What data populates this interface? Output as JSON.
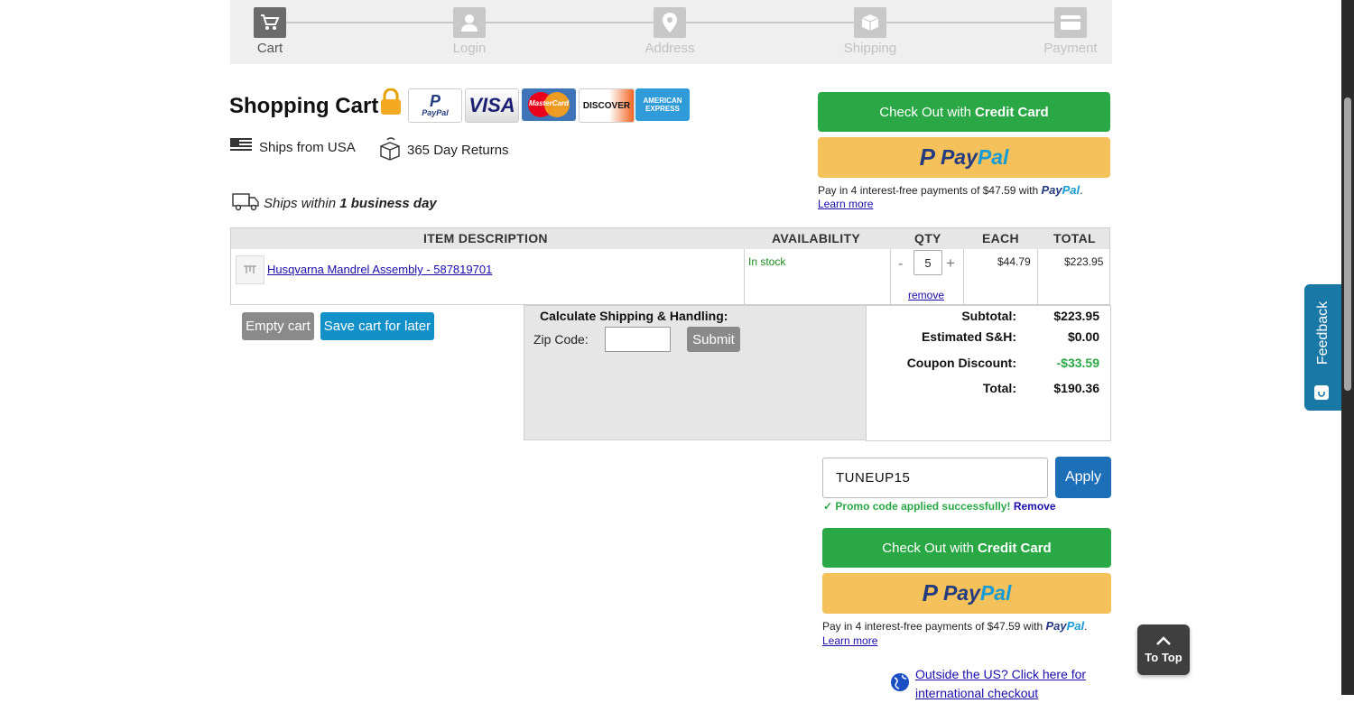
{
  "steps": [
    {
      "label": "Cart",
      "icon": "cart-icon",
      "active": true
    },
    {
      "label": "Login",
      "icon": "user-icon",
      "active": false
    },
    {
      "label": "Address",
      "icon": "map-pin-icon",
      "active": false
    },
    {
      "label": "Shipping",
      "icon": "box-icon",
      "active": false
    },
    {
      "label": "Payment",
      "icon": "credit-card-icon",
      "active": false
    }
  ],
  "header": {
    "title": "Shopping Cart",
    "payment_logos": [
      "PayPal",
      "VISA",
      "MasterCard",
      "DISCOVER",
      "AMERICAN EXPRESS"
    ]
  },
  "info": {
    "ships_from": "Ships from USA",
    "returns": "365 Day Returns",
    "ships_within_pre": "Ships within ",
    "ships_within_bold": "1 business day"
  },
  "checkout": {
    "credit_pre": "Check Out with ",
    "credit_bold": "Credit Card",
    "paypal_a": "Pay",
    "paypal_b": "Pal",
    "pay_in_4": "Pay in 4 interest-free payments of $47.59 with",
    "learn_more": "Learn more"
  },
  "table": {
    "headers": {
      "item": "ITEM DESCRIPTION",
      "availability": "AVAILABILITY",
      "qty": "QTY",
      "each": "EACH",
      "total": "TOTAL"
    },
    "row": {
      "name": "Husqvarna Mandrel Assembly - 587819701",
      "availability": "In stock",
      "qty": "5",
      "minus": "-",
      "plus": "+",
      "remove": "remove",
      "each": "$44.79",
      "total": "$223.95"
    }
  },
  "cart_actions": {
    "empty": "Empty cart",
    "save": "Save cart for later"
  },
  "shipping_calc": {
    "title": "Calculate Shipping & Handling:",
    "zip_label": "Zip Code:",
    "zip_value": "",
    "submit": "Submit"
  },
  "totals": {
    "subtotal_label": "Subtotal:",
    "subtotal": "$223.95",
    "sh_label": "Estimated S&H:",
    "sh": "$0.00",
    "coupon_label": "Coupon Discount:",
    "coupon": "-$33.59",
    "total_label": "Total:",
    "total": "$190.36"
  },
  "promo": {
    "code": "TUNEUP15",
    "apply": "Apply",
    "check": "✓",
    "success": "Promo code applied successfully!",
    "remove": "Remove"
  },
  "international": {
    "line1": "Outside the US? Click here for",
    "line2": "international checkout"
  },
  "feedback": "Feedback",
  "to_top": "To Top",
  "colors": {
    "green": "#2aa845",
    "paypal_yellow": "#f5c15a",
    "blue": "#1290c8",
    "discount_green": "#2aa845"
  }
}
